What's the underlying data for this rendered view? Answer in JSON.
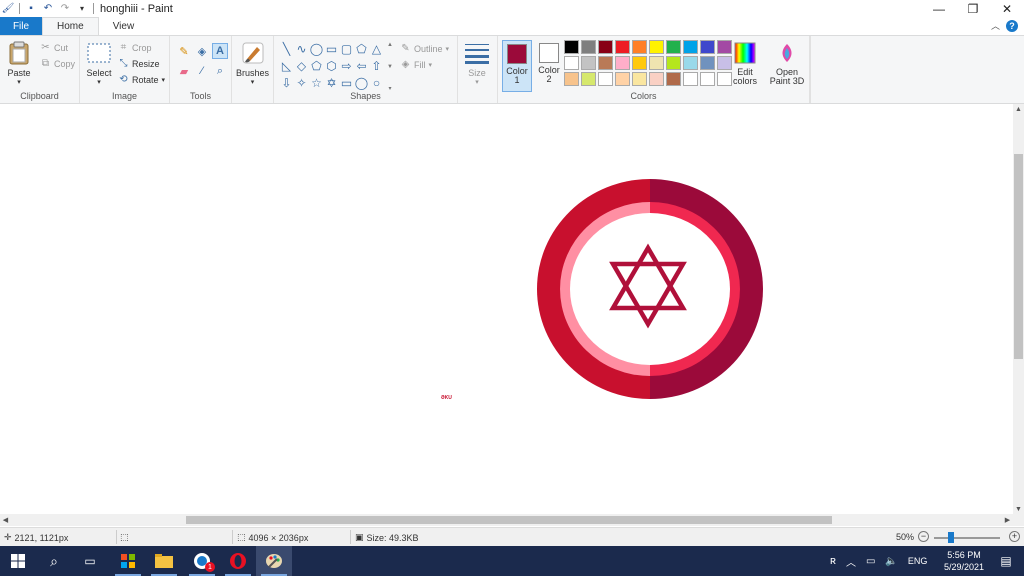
{
  "window": {
    "title": "honghiii - Paint",
    "controls": [
      "minimize",
      "restore",
      "close"
    ]
  },
  "tabs": {
    "file": "File",
    "home": "Home",
    "view": "View"
  },
  "ribbon": {
    "clipboard": {
      "label": "Clipboard",
      "paste": "Paste",
      "cut": "Cut",
      "copy": "Copy"
    },
    "image": {
      "label": "Image",
      "select": "Select",
      "crop": "Crop",
      "resize": "Resize",
      "rotate": "Rotate"
    },
    "tools": {
      "label": "Tools"
    },
    "brushes": {
      "label": "Brushes"
    },
    "shapes": {
      "label": "Shapes",
      "outline": "Outline",
      "fill": "Fill"
    },
    "size": {
      "label": "Size"
    },
    "colors": {
      "label": "Colors",
      "color1_label": "Color 1",
      "color2_label": "Color 2",
      "color1_value": "#9b0a3a",
      "color2_value": "#ffffff",
      "edit_colors": "Edit colors",
      "palette": [
        "#000000",
        "#7f7f7f",
        "#880015",
        "#ed1c24",
        "#ff7f27",
        "#fff200",
        "#22b14c",
        "#00a2e8",
        "#3f48cc",
        "#a349a4",
        "#ffffff",
        "#c3c3c3",
        "#b97a57",
        "#ffaec9",
        "#ffc90e",
        "#efe4b0",
        "#b5e61d",
        "#99d9ea",
        "#7092be",
        "#c8bfe7",
        "#f7c38c",
        "#d6e86d",
        "#ffffff",
        "#ffd2a6",
        "#fae6a0",
        "#f9d0c4",
        "#b06a4a",
        "#ffffff",
        "#ffffff",
        "#ffffff"
      ]
    },
    "paint3d": {
      "label": "Open Paint 3D"
    }
  },
  "canvas": {
    "tiny_text": "ƏKU",
    "drawing": {
      "outer_left_color": "#c8102e",
      "outer_right_color": "#9b0a3a",
      "inner_left_color": "#ff8fa3",
      "inner_right_color": "#f02850",
      "center_color": "#ffffff",
      "star_color": "#b0103a"
    }
  },
  "statusbar": {
    "cursor_pos": "2121, 1121px",
    "image_size": "4096 × 2036px",
    "file_size": "Size: 49.3KB",
    "zoom": "50%",
    "zoom_fraction": 0.25
  },
  "taskbar": {
    "language": "ENG",
    "time": "5:56 PM",
    "date": "5/29/2021",
    "notification_badge": "1"
  }
}
